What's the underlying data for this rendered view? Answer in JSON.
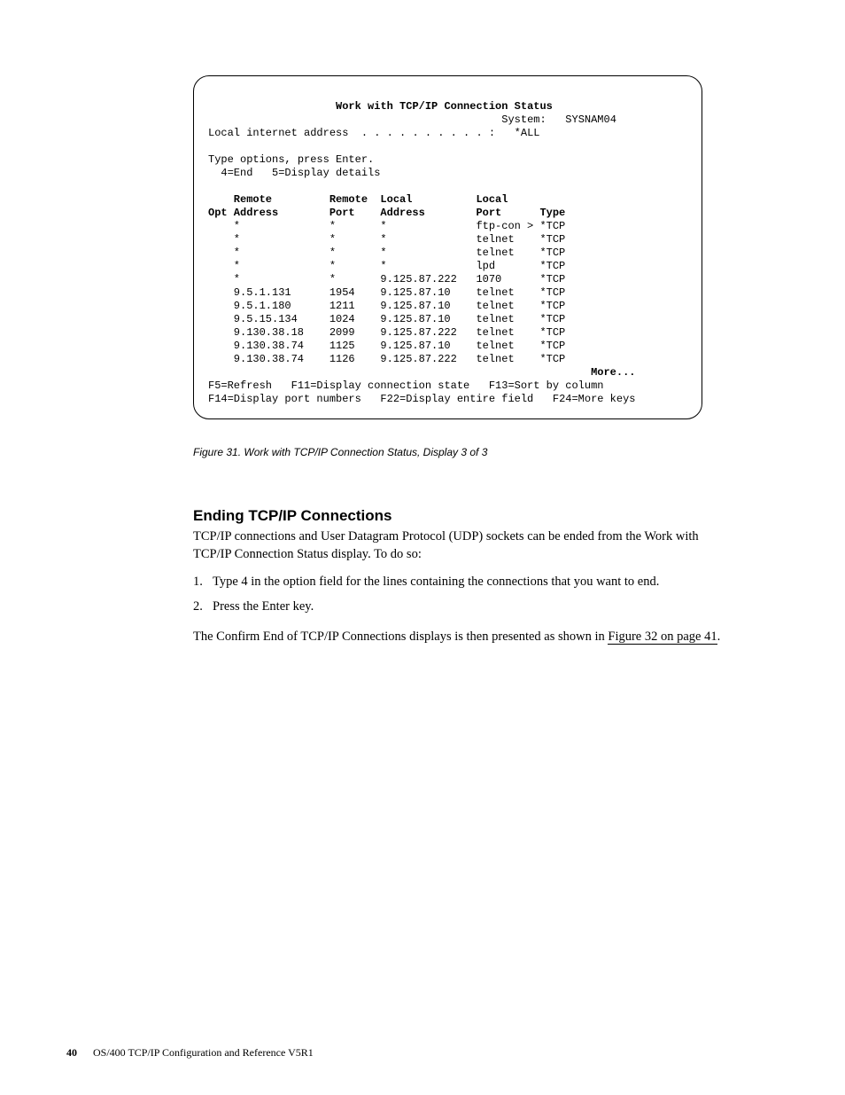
{
  "terminal": {
    "title": "Work with TCP/IP Connection Status",
    "system_label": "System:",
    "system_name": "SYSNAM04",
    "local_addr_label": "Local internet address  . . . . . . . . . . :",
    "local_addr_value": "*ALL",
    "instruction1": "Type options, press Enter.",
    "instruction2": "  4=End   5=Display details",
    "headers": {
      "opt": "Opt",
      "remote_address_top": "Remote",
      "remote_address_bot": "Address",
      "remote_port_top": "Remote",
      "remote_port_bot": "Port",
      "local_address_top": "Local",
      "local_address_bot": "Address",
      "local_port_top": "Local",
      "local_port_bot": "Port",
      "type": "Type"
    },
    "rows": [
      {
        "raddr": "*",
        "rport": "*",
        "laddr": "*",
        "lport": "ftp-con >",
        "type": "*TCP"
      },
      {
        "raddr": "*",
        "rport": "*",
        "laddr": "*",
        "lport": "telnet",
        "type": "*TCP"
      },
      {
        "raddr": "*",
        "rport": "*",
        "laddr": "*",
        "lport": "telnet",
        "type": "*TCP"
      },
      {
        "raddr": "*",
        "rport": "*",
        "laddr": "*",
        "lport": "lpd",
        "type": "*TCP"
      },
      {
        "raddr": "*",
        "rport": "*",
        "laddr": "9.125.87.222",
        "lport": "1070",
        "type": "*TCP"
      },
      {
        "raddr": "9.5.1.131",
        "rport": "1954",
        "laddr": "9.125.87.10",
        "lport": "telnet",
        "type": "*TCP"
      },
      {
        "raddr": "9.5.1.180",
        "rport": "1211",
        "laddr": "9.125.87.10",
        "lport": "telnet",
        "type": "*TCP"
      },
      {
        "raddr": "9.5.15.134",
        "rport": "1024",
        "laddr": "9.125.87.10",
        "lport": "telnet",
        "type": "*TCP"
      },
      {
        "raddr": "9.130.38.18",
        "rport": "2099",
        "laddr": "9.125.87.222",
        "lport": "telnet",
        "type": "*TCP"
      },
      {
        "raddr": "9.130.38.74",
        "rport": "1125",
        "laddr": "9.125.87.10",
        "lport": "telnet",
        "type": "*TCP"
      },
      {
        "raddr": "9.130.38.74",
        "rport": "1126",
        "laddr": "9.125.87.222",
        "lport": "telnet",
        "type": "*TCP"
      }
    ],
    "more": "More...",
    "fkeys1": "F5=Refresh   F11=Display connection state   F13=Sort by column",
    "fkeys2": "F14=Display port numbers   F22=Display entire field   F24=More keys"
  },
  "caption": "Figure 31. Work with TCP/IP Connection Status, Display 3 of 3",
  "heading": "Ending TCP/IP Connections",
  "para1": "TCP/IP connections and User Datagram Protocol (UDP) sockets can be ended from the Work with TCP/IP Connection Status display. To do so:",
  "list": {
    "item1num": "1.",
    "item1": "Type 4 in the option field for the lines containing the connections that you want to end.",
    "item2num": "2.",
    "item2": "Press the Enter key."
  },
  "para2a": "The Confirm End of TCP/IP Connections displays is then presented as shown in ",
  "para2link": "Figure 32 on page 41",
  "para2b": ".",
  "footer": {
    "pagenum": "40",
    "text": "OS/400 TCP/IP Configuration and Reference V5R1"
  }
}
